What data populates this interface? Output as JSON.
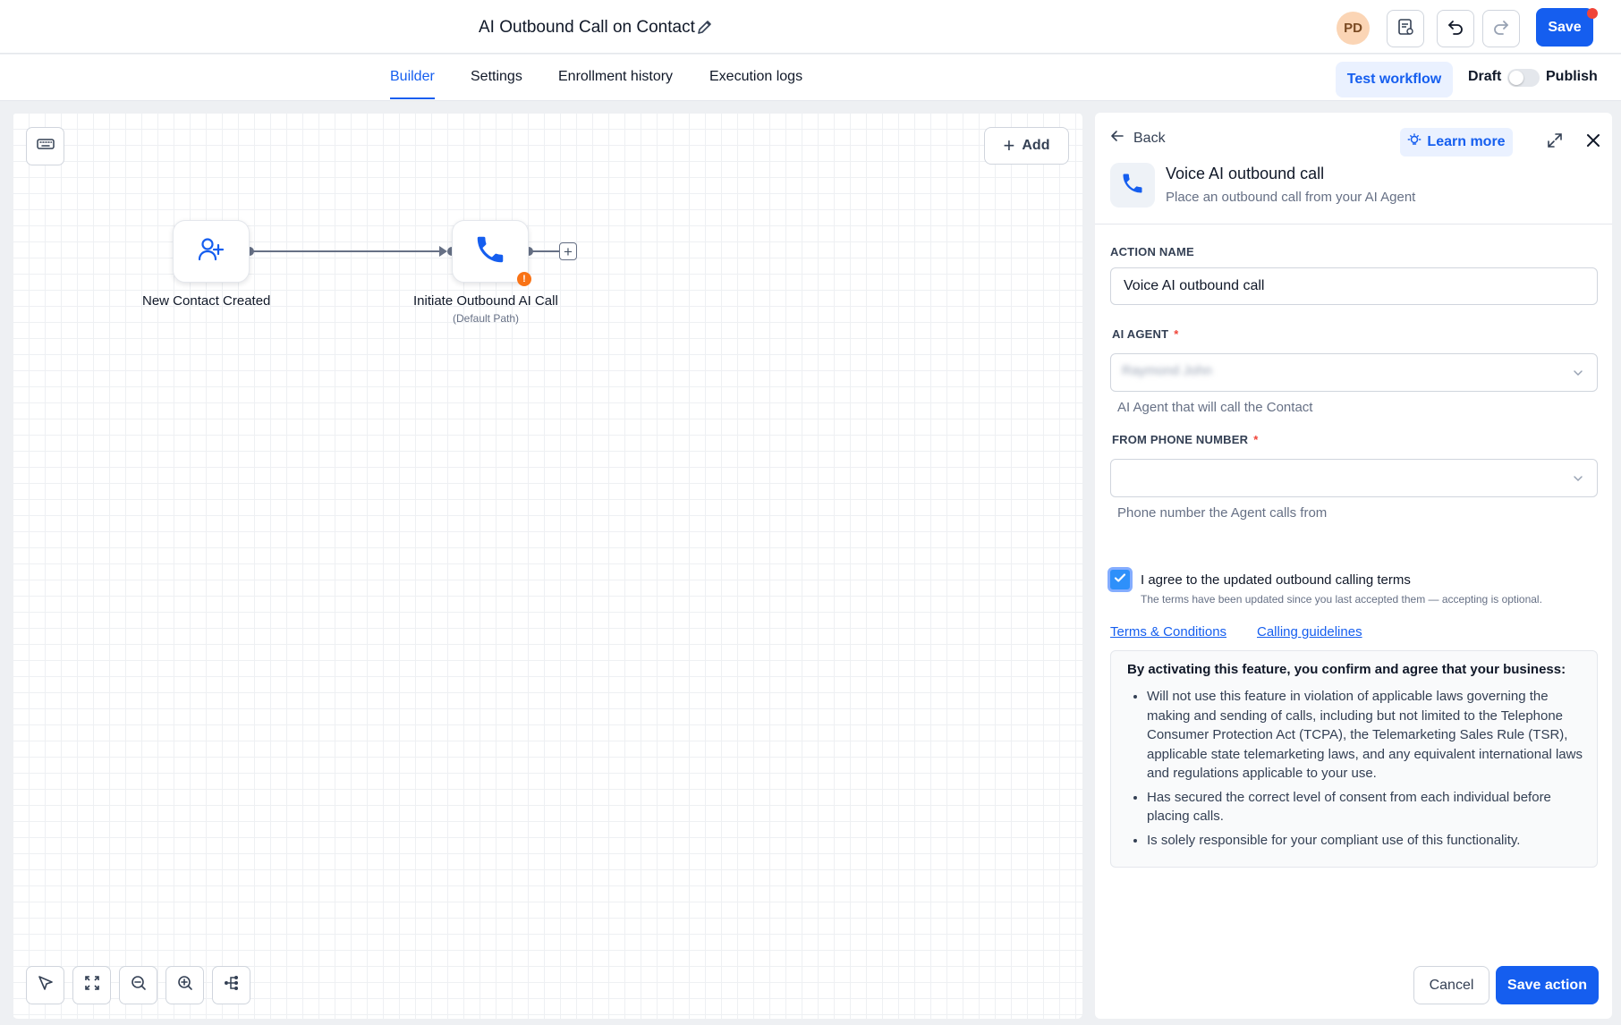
{
  "header": {
    "workflow_title": "AI Outbound Call on Contact",
    "avatar_initials": "PD",
    "save_label": "Save"
  },
  "tabs": [
    {
      "label": "Builder",
      "active": true
    },
    {
      "label": "Settings",
      "active": false
    },
    {
      "label": "Enrollment history",
      "active": false
    },
    {
      "label": "Execution logs",
      "active": false
    }
  ],
  "publish_bar": {
    "test_label": "Test workflow",
    "draft_label": "Draft",
    "publish_label": "Publish",
    "published": false
  },
  "canvas": {
    "add_label": "Add",
    "nodes": [
      {
        "label": "New Contact Created",
        "icon": "user-plus-icon"
      },
      {
        "label": "Initiate Outbound AI Call",
        "sublabel": "(Default Path)",
        "icon": "phone-icon",
        "warning": true
      }
    ]
  },
  "panel": {
    "back_label": "Back",
    "learn_more_label": "Learn more",
    "action_title": "Voice AI outbound call",
    "action_subtitle": "Place an outbound call from your AI Agent",
    "action_name_label": "ACTION NAME",
    "action_name_value": "Voice AI outbound call",
    "ai_agent_label": "AI AGENT",
    "ai_agent_value": "Raymond John",
    "ai_agent_help": "AI Agent that will call the Contact",
    "from_phone_label": "FROM PHONE NUMBER",
    "from_phone_value": "",
    "from_phone_help": "Phone number the Agent calls from",
    "agree_checked": true,
    "agree_label": "I agree to the updated outbound calling terms",
    "agree_note": "The terms have been updated since you last accepted them — accepting is optional.",
    "terms_link": "Terms & Conditions",
    "guidelines_link": "Calling guidelines",
    "terms_heading": "By activating this feature, you confirm and agree that your business:",
    "terms_items": [
      "Will not use this feature in violation of applicable laws governing the making and sending of calls, including but not limited to the Telephone Consumer Protection Act (TCPA), the Telemarketing Sales Rule (TSR), applicable state telemarketing laws, and any equivalent international laws and regulations applicable to your use.",
      "Has secured the correct level of consent from each individual before placing calls.",
      "Is solely responsible for your compliant use of this functionality."
    ],
    "cancel_label": "Cancel",
    "save_action_label": "Save action"
  },
  "colors": {
    "primary": "#155eef",
    "warning": "#f97316",
    "required": "#f04438"
  }
}
